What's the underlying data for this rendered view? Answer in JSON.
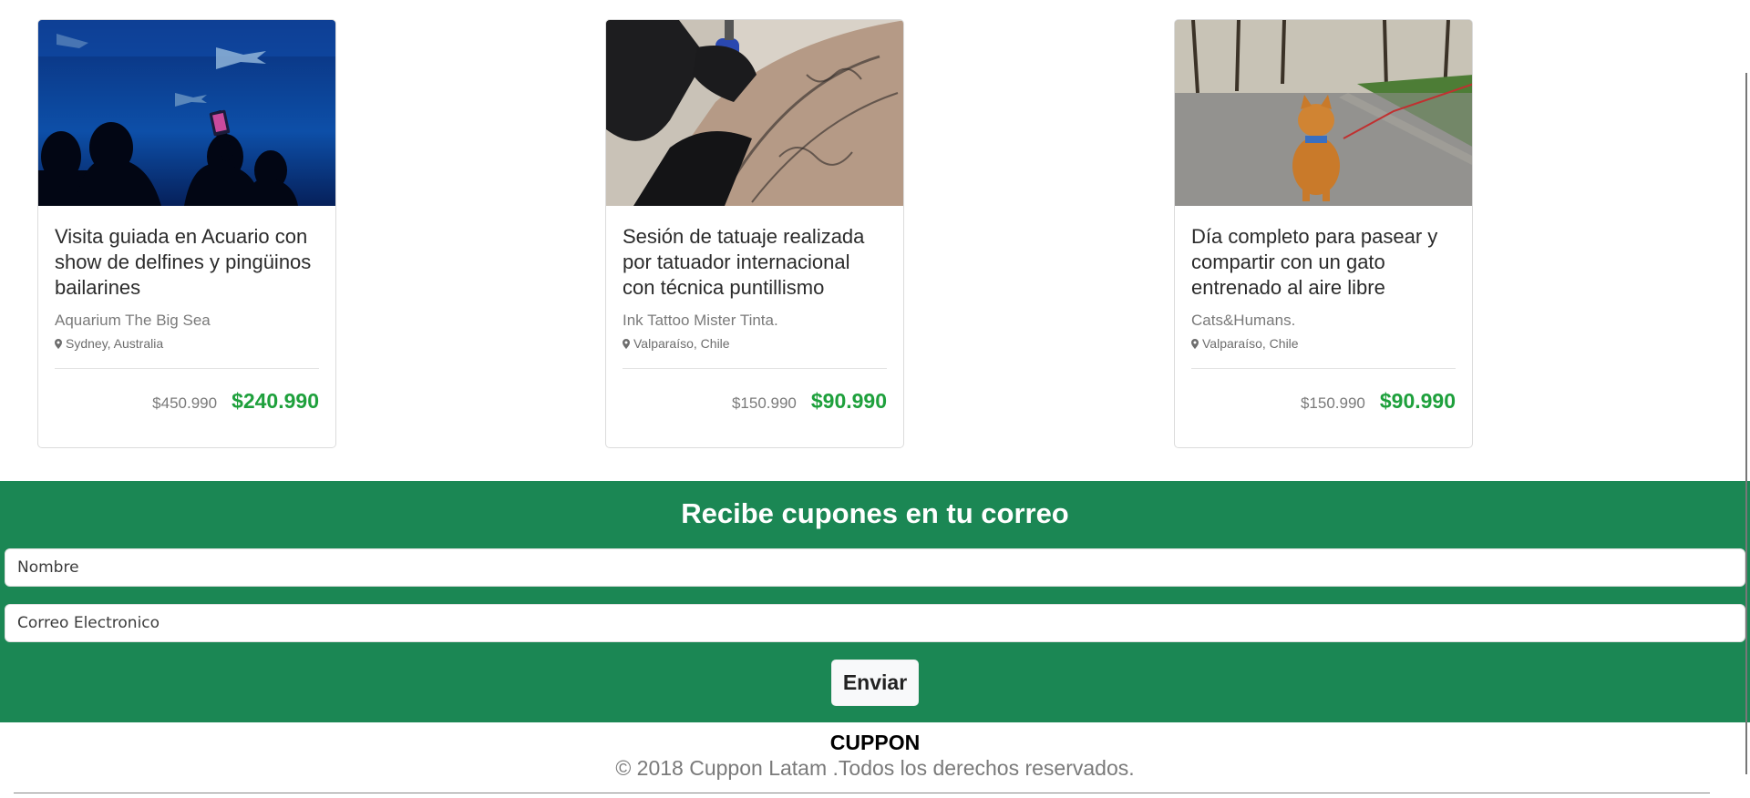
{
  "cards": [
    {
      "title": "Visita guiada en Acuario con show de delfines y pingüinos bailarines",
      "vendor": "Aquarium The Big Sea",
      "location": "Sydney, Australia",
      "old_price": "$450.990",
      "new_price": "$240.990",
      "image": "aquarium-photo"
    },
    {
      "title": "Sesión de tatuaje realizada por tatuador internacional con técnica puntillismo",
      "vendor": "Ink Tattoo Mister Tinta.",
      "location": "Valparaíso, Chile",
      "old_price": "$150.990",
      "new_price": "$90.990",
      "image": "tattoo-photo"
    },
    {
      "title": "Día completo para pasear y compartir con un gato entrenado al aire libre",
      "vendor": "Cats&Humans.",
      "location": "Valparaíso, Chile",
      "old_price": "$150.990",
      "new_price": "$90.990",
      "image": "cat-photo"
    }
  ],
  "newsletter": {
    "heading": "Recibe cupones en tu correo",
    "name_placeholder": "Nombre",
    "email_placeholder": "Correo Electronico",
    "submit_label": "Enviar"
  },
  "footer": {
    "brand": "CUPPON",
    "copyright": "© 2018 Cuppon Latam .Todos los derechos reservados."
  },
  "colors": {
    "accent_green": "#1b8754",
    "price_green": "#1ea03c"
  },
  "icons": {
    "location": "map-pin-icon"
  }
}
